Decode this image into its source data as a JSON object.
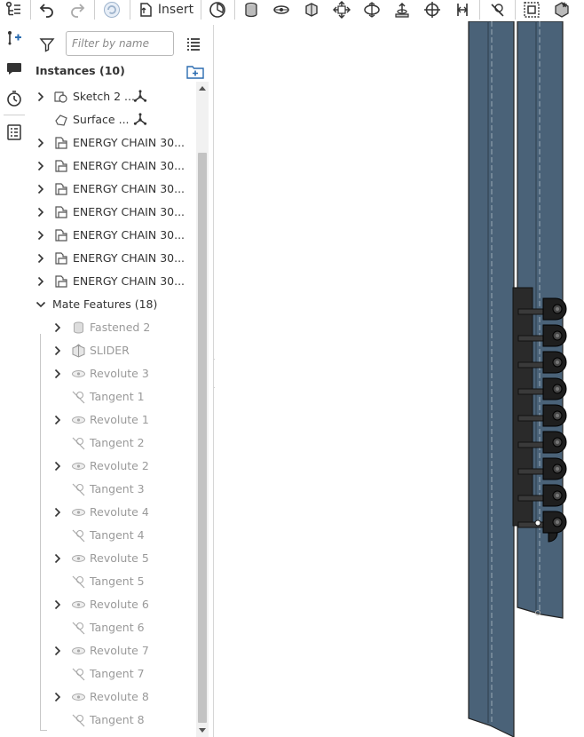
{
  "toolbar": {
    "insert_label": "Insert",
    "icons": [
      "tree-connect-icon",
      "undo-icon",
      "redo-icon",
      "orbit-icon",
      "insert-icon",
      "timer-icon",
      "cylinder-icon",
      "revolute-icon",
      "slider-icon",
      "planar-icon",
      "cylindrical-icon",
      "pin-slot-icon",
      "ball-icon",
      "parallel-icon",
      "tangent-icon",
      "group-icon",
      "mate-connector-icon"
    ]
  },
  "rail": {
    "icons": [
      "feature-add-icon",
      "comment-icon",
      "history-icon",
      "checklist-icon"
    ]
  },
  "panel": {
    "filter_placeholder": "Filter by name",
    "instances_title": "Instances (10)",
    "instances": [
      {
        "label": "Sketch 2 ...",
        "expandable": true,
        "icon": "sketch-icon",
        "badge": "origin-icon"
      },
      {
        "label": "Surface ...",
        "expandable": false,
        "icon": "surface-icon",
        "badge": "origin-icon"
      },
      {
        "label": "ENERGY CHAIN 30...",
        "expandable": true,
        "icon": "part-icon"
      },
      {
        "label": "ENERGY CHAIN 30...",
        "expandable": true,
        "icon": "part-icon"
      },
      {
        "label": "ENERGY CHAIN 30...",
        "expandable": true,
        "icon": "part-icon"
      },
      {
        "label": "ENERGY CHAIN 30...",
        "expandable": true,
        "icon": "part-icon"
      },
      {
        "label": "ENERGY CHAIN 30...",
        "expandable": true,
        "icon": "part-icon"
      },
      {
        "label": "ENERGY CHAIN 30...",
        "expandable": true,
        "icon": "part-icon"
      },
      {
        "label": "ENERGY CHAIN 30...",
        "expandable": true,
        "icon": "part-icon"
      }
    ],
    "mate_features_title": "Mate Features (18)",
    "mates": [
      {
        "label": "Fastened 2",
        "expandable": true,
        "icon": "fastened-icon"
      },
      {
        "label": "SLIDER",
        "expandable": true,
        "icon": "slider-mate-icon"
      },
      {
        "label": "Revolute 3",
        "expandable": true,
        "icon": "revolute-mate-icon"
      },
      {
        "label": "Tangent 1",
        "expandable": false,
        "icon": "tangent-mate-icon"
      },
      {
        "label": "Revolute 1",
        "expandable": true,
        "icon": "revolute-mate-icon"
      },
      {
        "label": "Tangent 2",
        "expandable": false,
        "icon": "tangent-mate-icon"
      },
      {
        "label": "Revolute 2",
        "expandable": true,
        "icon": "revolute-mate-icon"
      },
      {
        "label": "Tangent 3",
        "expandable": false,
        "icon": "tangent-mate-icon"
      },
      {
        "label": "Revolute 4",
        "expandable": true,
        "icon": "revolute-mate-icon"
      },
      {
        "label": "Tangent 4",
        "expandable": false,
        "icon": "tangent-mate-icon"
      },
      {
        "label": "Revolute 5",
        "expandable": true,
        "icon": "revolute-mate-icon"
      },
      {
        "label": "Tangent 5",
        "expandable": false,
        "icon": "tangent-mate-icon"
      },
      {
        "label": "Revolute 6",
        "expandable": true,
        "icon": "revolute-mate-icon"
      },
      {
        "label": "Tangent 6",
        "expandable": false,
        "icon": "tangent-mate-icon"
      },
      {
        "label": "Revolute 7",
        "expandable": true,
        "icon": "revolute-mate-icon"
      },
      {
        "label": "Tangent 7",
        "expandable": false,
        "icon": "tangent-mate-icon"
      },
      {
        "label": "Revolute 8",
        "expandable": true,
        "icon": "revolute-mate-icon"
      },
      {
        "label": "Tangent 8",
        "expandable": false,
        "icon": "tangent-mate-icon"
      }
    ]
  },
  "colors": {
    "rail_plate": "#4a6278",
    "chain_link": "#1e1e1e",
    "accent": "#2b6cb0"
  }
}
